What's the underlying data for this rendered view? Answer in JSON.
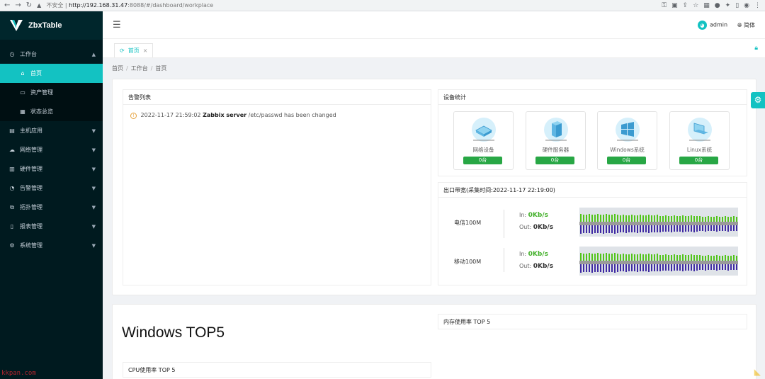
{
  "browser": {
    "security_label": "不安全",
    "url_host": "http://192.168.31.47",
    "url_rest": ":8088/#/dashboard/workplace"
  },
  "sidebar": {
    "app_name": "ZbxTable",
    "groups": [
      {
        "label": "工作台",
        "icon": "dashboard-icon"
      },
      {
        "label": "主机应用",
        "icon": "host-icon"
      },
      {
        "label": "网络管理",
        "icon": "cloud-icon"
      },
      {
        "label": "硬件管理",
        "icon": "hardware-icon"
      },
      {
        "label": "告警管理",
        "icon": "alarm-icon"
      },
      {
        "label": "拓扑管理",
        "icon": "topology-icon"
      },
      {
        "label": "报表管理",
        "icon": "report-icon"
      },
      {
        "label": "系统管理",
        "icon": "settings-icon"
      }
    ],
    "sub_items": [
      {
        "label": "首页",
        "icon": "home-icon",
        "active": true
      },
      {
        "label": "资产管理",
        "icon": "calendar-icon"
      },
      {
        "label": "状态总览",
        "icon": "grid-icon"
      }
    ],
    "watermark": "kkpan.com"
  },
  "header": {
    "user": "admin",
    "language": "简体"
  },
  "tabs": [
    {
      "label": "首页"
    }
  ],
  "breadcrumb": [
    "首页",
    "工作台",
    "首页"
  ],
  "alerts": {
    "title": "告警列表",
    "items": [
      {
        "time": "2022-11-17 21:59:02",
        "host": "Zabbix server",
        "message": "/etc/passwd has been changed"
      }
    ]
  },
  "device_stats": {
    "title": "设备统计",
    "devices": [
      {
        "name": "网络设备",
        "count": "0台"
      },
      {
        "name": "硬件服务器",
        "count": "0台"
      },
      {
        "name": "Windows系统",
        "count": "0台"
      },
      {
        "name": "Linux系统",
        "count": "0台"
      }
    ]
  },
  "bandwidth": {
    "title": "出口带宽(采集时间:2022-11-17 22:19:00)",
    "in_label": "In:",
    "out_label": "Out:",
    "lines": [
      {
        "name": "电信100M",
        "in": "0Kb/s",
        "out": "0Kb/s"
      },
      {
        "name": "移动100M",
        "in": "0Kb/s",
        "out": "0Kb/s"
      }
    ],
    "colors": {
      "in": "#52c41a",
      "out": "#3f2aa3"
    }
  },
  "windows_top": {
    "title": "Windows TOP5",
    "cpu_title": "CPU使用率 TOP 5",
    "mem_title": "内存使用率 TOP 5"
  },
  "colors": {
    "accent": "#13c2c2",
    "sidebar": "#001a1f",
    "badge": "#28a745"
  }
}
